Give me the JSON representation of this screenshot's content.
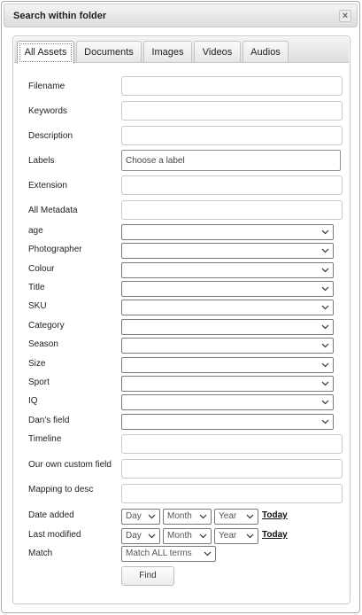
{
  "dialog": {
    "title": "Search within folder",
    "close_glyph": "×"
  },
  "tabs": [
    "All Assets",
    "Documents",
    "Images",
    "Videos",
    "Audios"
  ],
  "active_tab": "All Assets",
  "fields": {
    "filename": "Filename",
    "keywords": "Keywords",
    "description": "Description",
    "labels": "Labels",
    "labels_placeholder": "Choose a label",
    "extension": "Extension",
    "all_metadata": "All Metadata",
    "age": "age",
    "photographer": "Photographer",
    "colour": "Colour",
    "title": "Title",
    "sku": "SKU",
    "category": "Category",
    "season": "Season",
    "size": "Size",
    "sport": "Sport",
    "iq": "IQ",
    "dans_field": "Dan's field",
    "timeline": "Timeline",
    "our_own_custom_field": "Our own custom field",
    "mapping_to_desc": "Mapping to desc",
    "date_added": "Date added",
    "last_modified": "Last modified",
    "match": "Match"
  },
  "date_selects": {
    "day": "Day",
    "month": "Month",
    "year": "Year",
    "today_link": "Today"
  },
  "match_select": {
    "value": "Match ALL terms"
  },
  "find_button": "Find"
}
